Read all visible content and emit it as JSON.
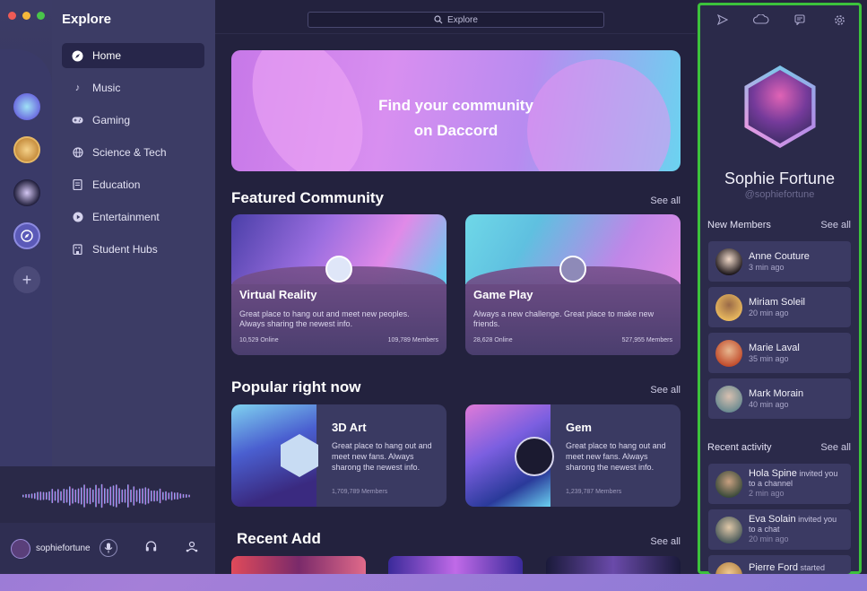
{
  "sidebar": {
    "title": "Explore",
    "items": [
      {
        "label": "Home",
        "icon": "compass-icon"
      },
      {
        "label": "Music",
        "icon": "music-note-icon"
      },
      {
        "label": "Gaming",
        "icon": "gamepad-icon"
      },
      {
        "label": "Science & Tech",
        "icon": "globe-icon"
      },
      {
        "label": "Education",
        "icon": "book-icon"
      },
      {
        "label": "Entertainment",
        "icon": "play-icon"
      },
      {
        "label": "Student Hubs",
        "icon": "building-icon"
      }
    ]
  },
  "userbar": {
    "username": "sophiefortune"
  },
  "search": {
    "placeholder": "Explore"
  },
  "hero": {
    "line1": "Find your community",
    "line2": "on Daccord"
  },
  "featured": {
    "title": "Featured Community",
    "see_all": "See all",
    "cards": [
      {
        "title": "Virtual Reality",
        "desc": "Great place to hang out and meet new peoples. Always sharing the newest info.",
        "online": "10,529 Online",
        "members": "109,789 Members"
      },
      {
        "title": "Game Play",
        "desc": "Always a new challenge. Great place to make new friends.",
        "online": "28,628 Online",
        "members": "527,955 Members"
      }
    ]
  },
  "popular": {
    "title": "Popular right now",
    "see_all": "See all",
    "cards": [
      {
        "title": "3D Art",
        "desc": "Great place to hang out and meet new fans. Always sharong the newest info.",
        "members": "1,709,789 Members"
      },
      {
        "title": "Gem",
        "desc": "Great place to hang out and meet new fans. Always sharong the newest info.",
        "members": "1,239,787 Members"
      }
    ]
  },
  "recent_add": {
    "title": "Recent Add",
    "see_all": "See all"
  },
  "profile": {
    "name": "Sophie Fortune",
    "handle": "@sophiefortune"
  },
  "new_members": {
    "title": "New Members",
    "see_all": "See all",
    "items": [
      {
        "name": "Anne Couture",
        "time": "3 min ago"
      },
      {
        "name": "Miriam Soleil",
        "time": "20 min ago"
      },
      {
        "name": "Marie Laval",
        "time": "35 min ago"
      },
      {
        "name": "Mark  Morain",
        "time": "40 min ago"
      }
    ]
  },
  "recent_activity": {
    "title": "Recent activity",
    "see_all": "See all",
    "items": [
      {
        "name": "Hola Spine",
        "action": "invited you",
        "detail": "to a channel",
        "time": "2 min ago"
      },
      {
        "name": "Eva Solain",
        "action": "invited you",
        "detail": "to a chat",
        "time": "20 min ago"
      },
      {
        "name": "Pierre Ford",
        "action": "started",
        "detail": "",
        "time": ""
      }
    ]
  },
  "colors": {
    "accent_border": "#3cc23c",
    "window_bg": "#26243f"
  }
}
